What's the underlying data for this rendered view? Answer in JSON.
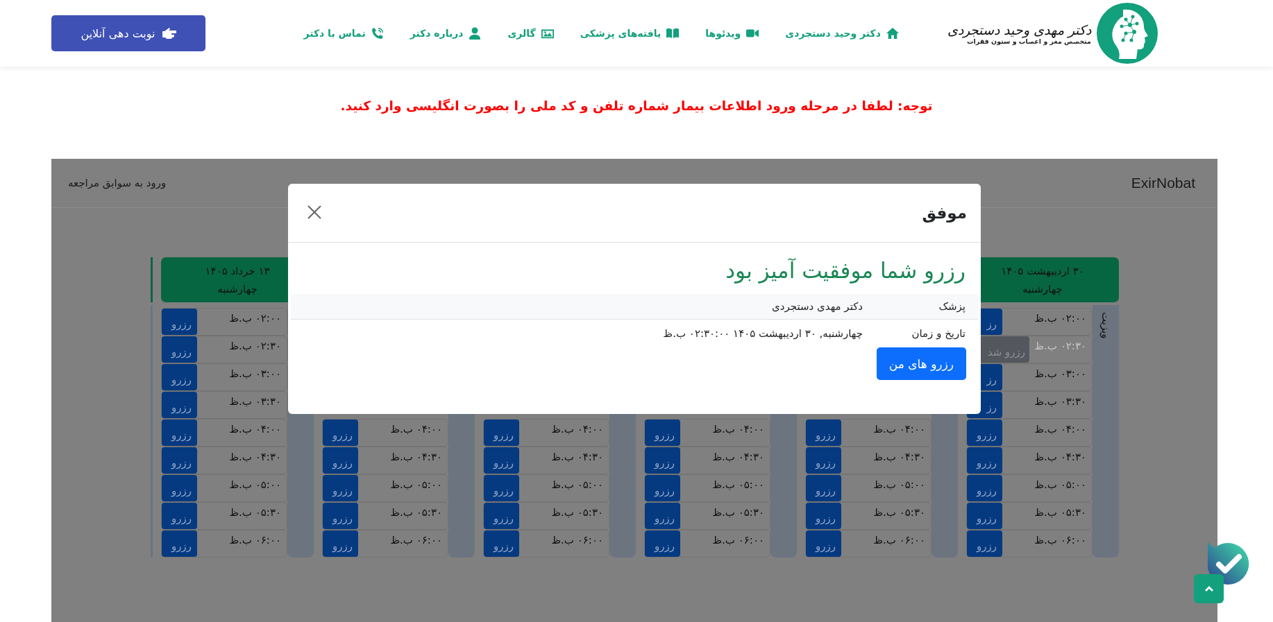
{
  "header": {
    "logo": {
      "title": "دکتر مهدی وحید دستجردی",
      "subtitle": "متخصص مغز و اعصاب و ستون فقرات"
    },
    "nav": [
      {
        "label": "دکتر وحید دستجردی"
      },
      {
        "label": "ویدئوها"
      },
      {
        "label": "یافته‌های پزشکی"
      },
      {
        "label": "گالری"
      },
      {
        "label": "درباره دکتر"
      },
      {
        "label": "تماس با دکتر"
      }
    ],
    "cta": {
      "label": "نوبت دهی آنلاین"
    }
  },
  "notice": "توجه: لطفا در مرحله ورود اطلاعات بیمار شماره تلفن و کد ملی را بصورت انگلیسی وارد کنید.",
  "booking": {
    "brand": "ExirNobat",
    "history_link": "ورود به سوابق مراجعه",
    "days": [
      {
        "date": "۳۰ اردیبهشت ۱۴۰۵",
        "weekday": "چهارشنبه",
        "side_label": "ویزیت",
        "slots": [
          {
            "time": "۰۲:۰۰ ب.ظ",
            "action": "رز",
            "reserved": false
          },
          {
            "time": "۰۲:۳۰ ب.ظ",
            "action": "رزرو شد",
            "reserved": true
          },
          {
            "time": "۰۳:۰۰ ب.ظ",
            "action": "رز",
            "reserved": false
          },
          {
            "time": "۰۳:۳۰ ب.ظ",
            "action": "رز",
            "reserved": false
          },
          {
            "time": "۰۴:۰۰ ب.ظ",
            "action": "رزرو",
            "reserved": false
          },
          {
            "time": "۰۴:۳۰ ب.ظ",
            "action": "رزرو",
            "reserved": false
          },
          {
            "time": "۰۵:۰۰ ب.ظ",
            "action": "رزرو",
            "reserved": false
          },
          {
            "time": "۰۵:۳۰ ب.ظ",
            "action": "رزرو",
            "reserved": false
          },
          {
            "time": "۰۶:۰۰ ب.ظ",
            "action": "رزرو",
            "reserved": false
          }
        ]
      },
      {
        "slots": [
          {
            "time": "۰۴:۰۰ ب.ظ",
            "action": "رزرو",
            "reserved": false
          },
          {
            "time": "۰۴:۳۰ ب.ظ",
            "action": "رزرو",
            "reserved": false
          },
          {
            "time": "۰۵:۰۰ ب.ظ",
            "action": "رزرو",
            "reserved": false
          },
          {
            "time": "۰۵:۳۰ ب.ظ",
            "action": "رزرو",
            "reserved": false
          },
          {
            "time": "۰۶:۰۰ ب.ظ",
            "action": "رزرو",
            "reserved": false
          }
        ]
      },
      {
        "slots": [
          {
            "time": "۰۴:۰۰ ب.ظ",
            "action": "رزرو",
            "reserved": false
          },
          {
            "time": "۰۴:۳۰ ب.ظ",
            "action": "رزرو",
            "reserved": false
          },
          {
            "time": "۰۵:۰۰ ب.ظ",
            "action": "رزرو",
            "reserved": false
          },
          {
            "time": "۰۵:۳۰ ب.ظ",
            "action": "رزرو",
            "reserved": false
          },
          {
            "time": "۰۶:۰۰ ب.ظ",
            "action": "رزرو",
            "reserved": false
          }
        ]
      },
      {
        "slots": [
          {
            "time": "۰۴:۰۰ ب.ظ",
            "action": "رزرو",
            "reserved": false
          },
          {
            "time": "۰۴:۳۰ ب.ظ",
            "action": "رزرو",
            "reserved": false
          },
          {
            "time": "۰۵:۰۰ ب.ظ",
            "action": "رزرو",
            "reserved": false
          },
          {
            "time": "۰۵:۳۰ ب.ظ",
            "action": "رزرو",
            "reserved": false
          },
          {
            "time": "۰۶:۰۰ ب.ظ",
            "action": "رزرو",
            "reserved": false
          }
        ]
      },
      {
        "slots": [
          {
            "time": "۰۴:۰۰ ب.ظ",
            "action": "رزرو",
            "reserved": false
          },
          {
            "time": "۰۴:۳۰ ب.ظ",
            "action": "رزرو",
            "reserved": false
          },
          {
            "time": "۰۵:۰۰ ب.ظ",
            "action": "رزرو",
            "reserved": false
          },
          {
            "time": "۰۵:۳۰ ب.ظ",
            "action": "رزرو",
            "reserved": false
          },
          {
            "time": "۰۶:۰۰ ب.ظ",
            "action": "رزرو",
            "reserved": false
          }
        ]
      },
      {
        "date": "۱۳ خرداد ۱۴۰۵",
        "weekday": "چهارشنبه",
        "slots": [
          {
            "time": "۰۲:۰۰ ب.ظ",
            "action": "رزرو",
            "reserved": false
          },
          {
            "time": "۰۲:۳۰ ب.ظ",
            "action": "رزرو",
            "reserved": false
          },
          {
            "time": "۰۳:۰۰ ب.ظ",
            "action": "رزرو",
            "reserved": false
          },
          {
            "time": "۰۳:۳۰ ب.ظ",
            "action": "رزرو",
            "reserved": false
          },
          {
            "time": "۰۴:۰۰ ب.ظ",
            "action": "رزرو",
            "reserved": false
          },
          {
            "time": "۰۴:۳۰ ب.ظ",
            "action": "رزرو",
            "reserved": false
          },
          {
            "time": "۰۵:۰۰ ب.ظ",
            "action": "رزرو",
            "reserved": false
          },
          {
            "time": "۰۵:۳۰ ب.ظ",
            "action": "رزرو",
            "reserved": false
          },
          {
            "time": "۰۶:۰۰ ب.ظ",
            "action": "رزرو",
            "reserved": false
          }
        ]
      }
    ]
  },
  "modal": {
    "title": "موفق",
    "message": "رزرو شما موفقیت آمیز بود",
    "details": [
      {
        "label": "پزشک",
        "value": "دکتر مهدی دستجردی"
      },
      {
        "label": "تاریخ و زمان",
        "value": "چهارشنبه, ۳۰ اردیبهشت ۱۴۰۵ ۰۲:۳۰:۰۰ ب.ظ"
      }
    ],
    "button": "رزرو های من"
  }
}
